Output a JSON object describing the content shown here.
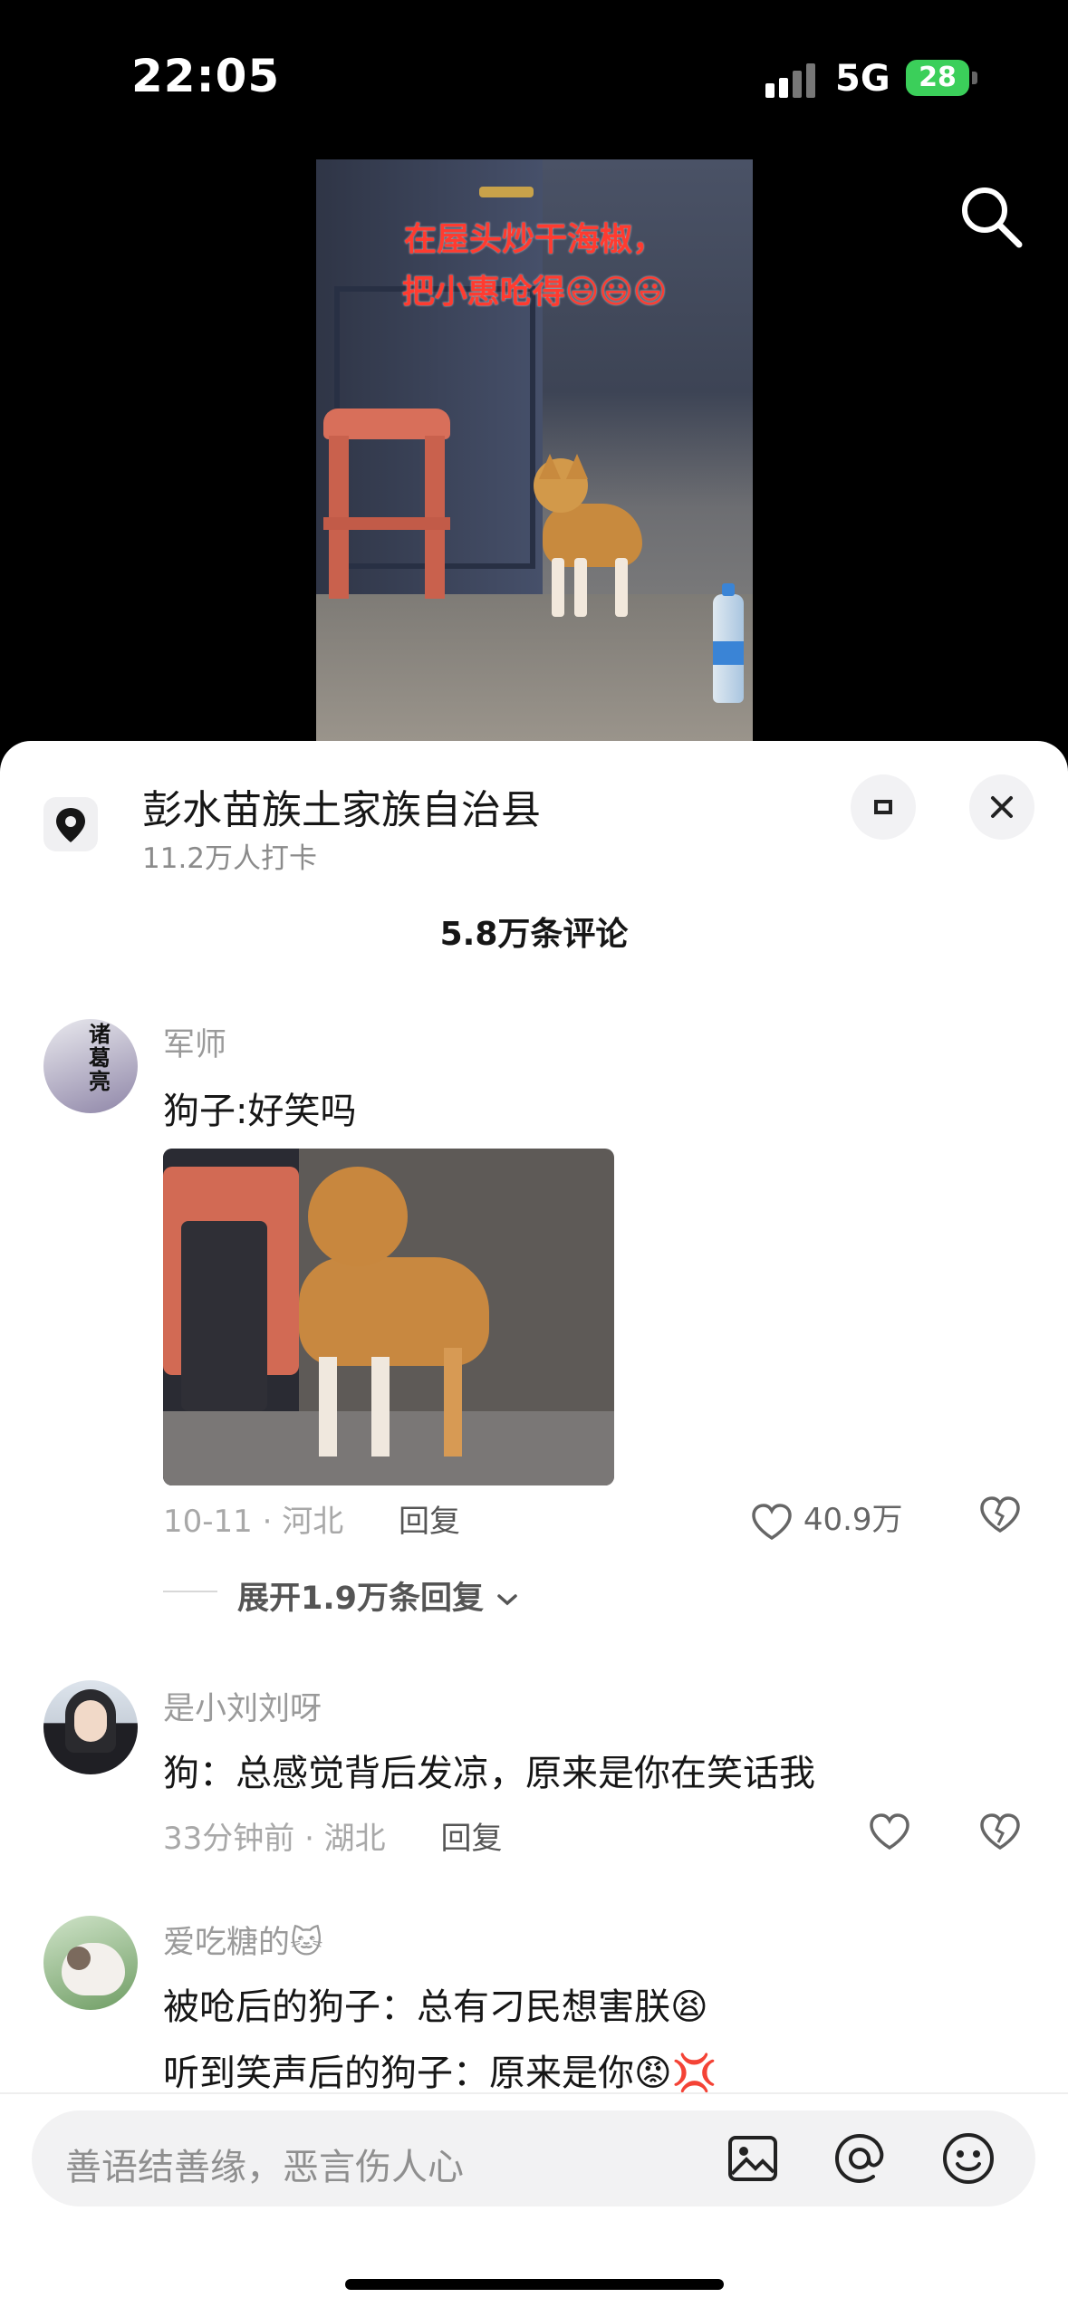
{
  "status": {
    "time": "22:05",
    "network": "5G",
    "battery": "28"
  },
  "video": {
    "caption_line1": "在屋头炒干海椒，",
    "caption_line2": "把小惠呛得😃😃😃"
  },
  "location": {
    "title": "彭水苗族土家族自治县",
    "subtitle": "11.2万人打卡"
  },
  "comments_header": {
    "count": "5.8万条评论"
  },
  "comments": [
    {
      "user": "军师",
      "avatar_text": "诸葛亮",
      "text": "狗子:好笑吗",
      "time_loc": "10-11 · 河北",
      "reply": "回复",
      "likes": "40.9万",
      "expand": "展开1.9万条回复"
    },
    {
      "user": "是小刘刘呀",
      "text": "狗：总感觉背后发凉，原来是你在笑话我",
      "time_loc": "33分钟前 · 湖北",
      "reply": "回复"
    },
    {
      "user": "爱吃糖的🐱",
      "text1": "被呛后的狗子：总有刁民想害朕😫",
      "text2": "听到笑声后的狗子：原来是你😡💢"
    }
  ],
  "input": {
    "placeholder": "善语结善缘，恶言伤人心"
  },
  "colors": {
    "accent_red": "#ff3b30",
    "battery_green": "#3bcf5a"
  }
}
